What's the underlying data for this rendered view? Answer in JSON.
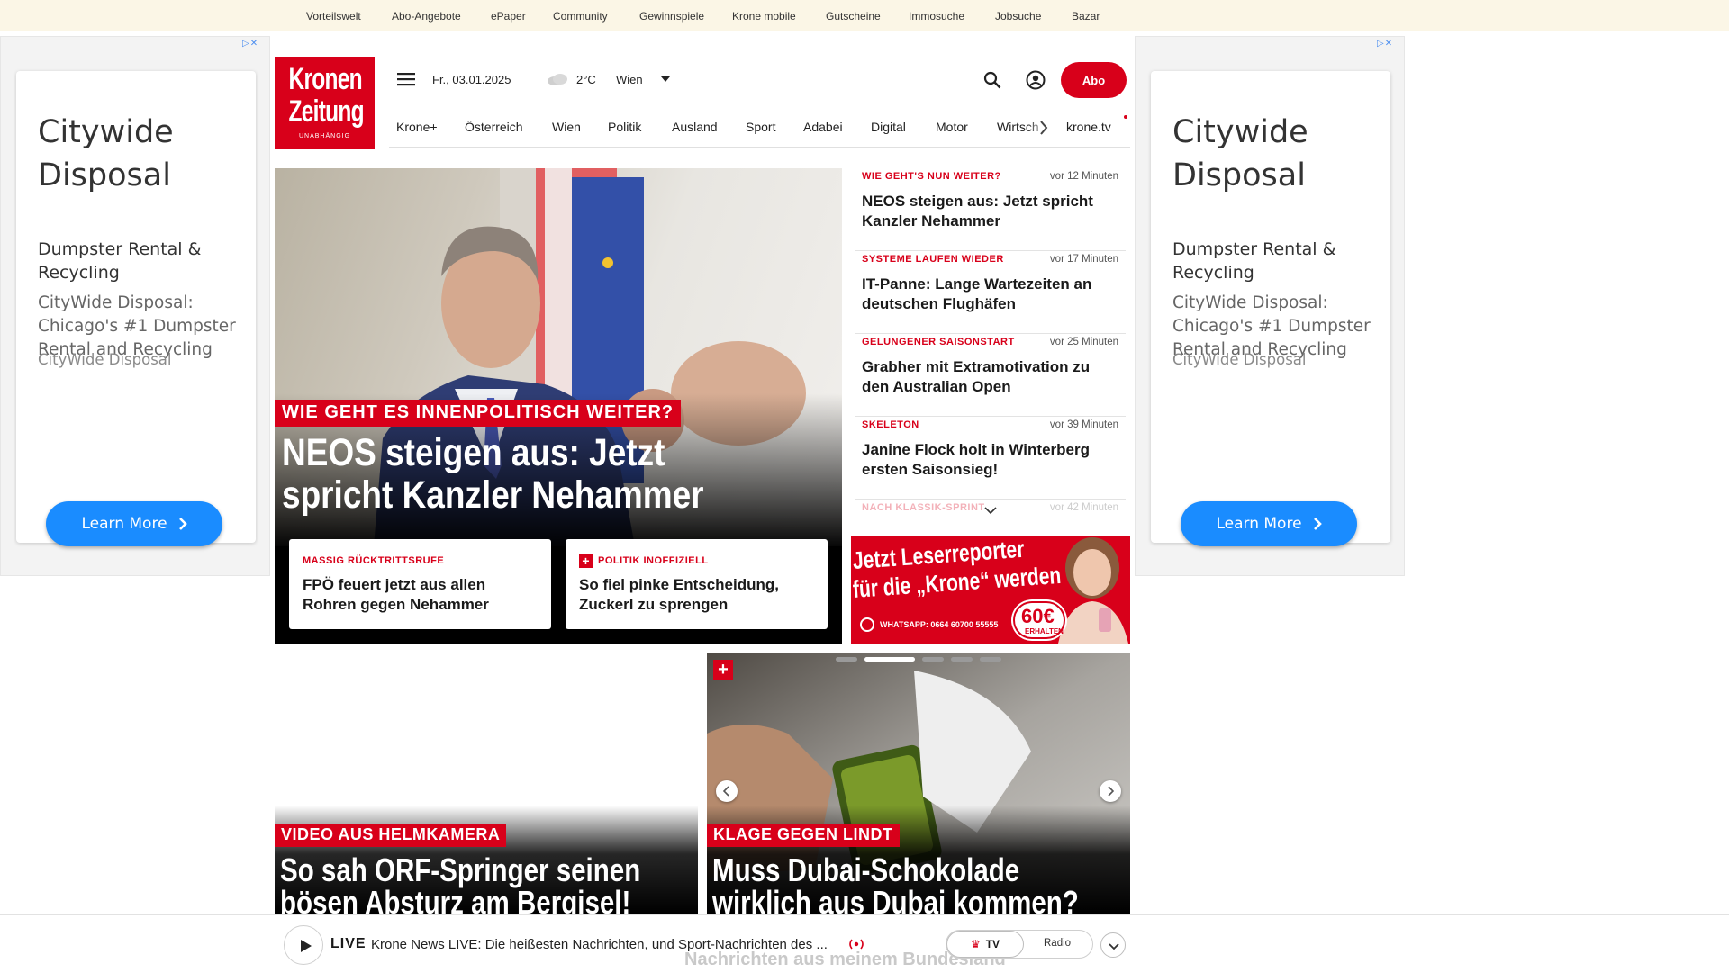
{
  "topbar": {
    "links": [
      "Vorteilswelt",
      "Abo-Angebote",
      "ePaper",
      "Community",
      "Gewinnspiele",
      "Krone mobile",
      "Gutscheine",
      "Immosuche",
      "Jobsuche",
      "Bazar"
    ]
  },
  "ads": {
    "title": "Citywide Disposal",
    "subtitle": "Dumpster Rental & Recycling",
    "body": "CityWide Disposal: Chicago's #1 Dumpster Rental and Recycling",
    "brand": "CityWide Disposal",
    "cta": "Learn More"
  },
  "logo": {
    "line1": "Kronen",
    "line2": "Zeitung",
    "tagline": "UNABHÄNGIG"
  },
  "header": {
    "date": "Fr., 03.01.2025",
    "temperature": "2°C",
    "location": "Wien",
    "abo_label": "Abo"
  },
  "nav": {
    "items": [
      "Krone+",
      "Österreich",
      "Wien",
      "Politik",
      "Ausland",
      "Sport",
      "Adabei",
      "Digital",
      "Motor",
      "Wirtsch"
    ],
    "tv": "krone.tv"
  },
  "hero": {
    "kicker": "WIE GEHT ES INNENPOLITISCH WEITER?",
    "headline_l1": "NEOS steigen aus: Jetzt",
    "headline_l2": "spricht Kanzler Nehammer",
    "cards": [
      {
        "kicker": "MASSIG RÜCKTRITTSRUFE",
        "title": "FPÖ feuert jetzt aus allen Rohren gegen Nehammer",
        "plus": false
      },
      {
        "kicker": "POLITIK INOFFIZIELL",
        "title": "So fiel pinke Entscheidung, Zuckerl zu sprengen",
        "plus": true
      }
    ]
  },
  "ticker": {
    "items": [
      {
        "kicker": "WIE GEHT'S NUN WEITER?",
        "time": "vor 12 Minuten",
        "title": "NEOS steigen aus: Jetzt spricht Kanzler Nehammer"
      },
      {
        "kicker": "SYSTEME LAUFEN WIEDER",
        "time": "vor 17 Minuten",
        "title": "IT-Panne: Lange Wartezeiten an deutschen Flughäfen"
      },
      {
        "kicker": "GELUNGENER SAISONSTART",
        "time": "vor 25 Minuten",
        "title": "Grabher mit Extramotivation zu den Australian Open"
      },
      {
        "kicker": "SKELETON",
        "time": "vor 39 Minuten",
        "title": "Janine Flock holt in Winterberg ersten Saisonsieg!"
      },
      {
        "kicker": "NACH KLASSIK-SPRINT",
        "time": "vor 42 Minuten",
        "title": ""
      }
    ]
  },
  "leserreporter": {
    "line1": "Jetzt Leserreporter",
    "line2": "für die „Krone“ werden",
    "whatsapp": "WHATSAPP: 0664 60700 55555",
    "amount": "60€",
    "amount_sub": "ERHALTEN"
  },
  "stories": [
    {
      "kicker": "VIDEO AUS HELMKAMERA",
      "l1": "So sah ORF-Springer seinen",
      "l2": "bösen Absturz am Bergisel!"
    },
    {
      "kicker": "KLAGE GEGEN LINDT",
      "l1": "Muss Dubai-Schokolade",
      "l2": "wirklich aus Dubai kommen?"
    }
  ],
  "bottom_peek": "Nachrichten aus meinem Bundesland",
  "livebar": {
    "live": "LIVE",
    "text": "Krone News LIVE: Die heißesten Nachrichten, und Sport-Nachrichten des ...",
    "tv": "TV",
    "radio": "Radio"
  },
  "colors": {
    "brand_red": "#d8001a",
    "ad_blue": "#1a8cff",
    "topbar_bg": "#fbf6e6"
  }
}
